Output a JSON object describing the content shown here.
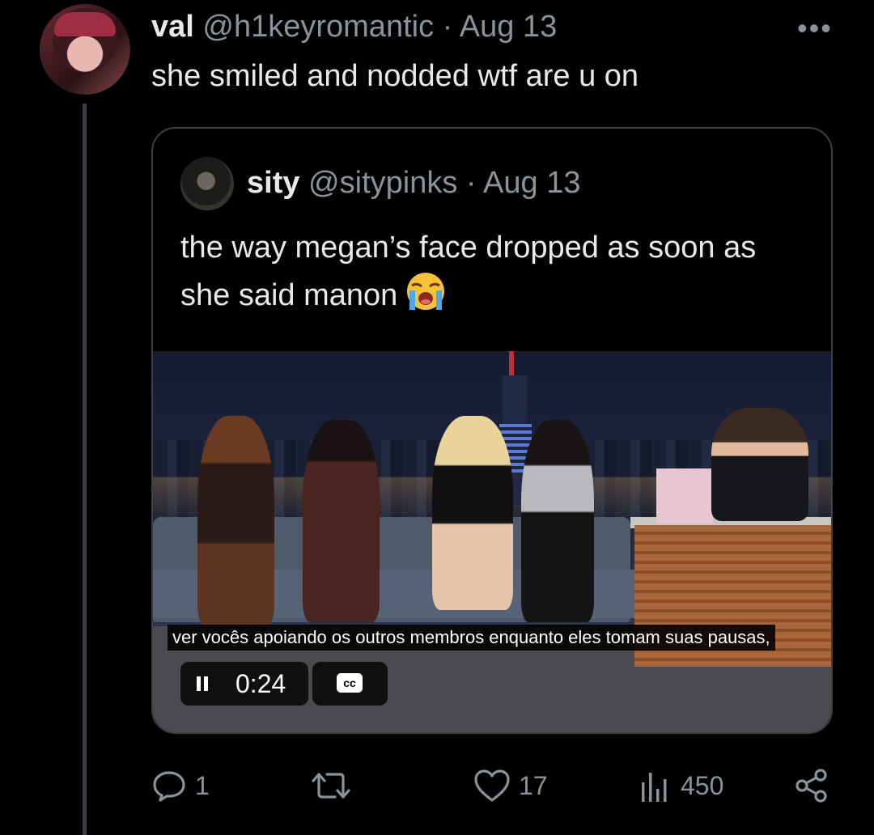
{
  "reply": {
    "name": "val",
    "handle": "@h1keyromantic",
    "separator": "·",
    "date": "Aug 13",
    "more": "•••",
    "text": "she smiled and nodded wtf are u on"
  },
  "quote": {
    "name": "sity",
    "handle": "@sitypinks",
    "separator": "·",
    "date": "Aug 13",
    "text": "the way megan’s face dropped as soon as she said manon",
    "emoji": "loudly-crying-face"
  },
  "video": {
    "subtitle": "ver vocês apoiando os outros membros enquanto eles tomam suas pausas,",
    "time": "0:24",
    "cc_label": "cc"
  },
  "actions": {
    "replies": "1",
    "retweets": "",
    "likes": "17",
    "views": "450"
  },
  "icons": {
    "reply": "reply-icon",
    "retweet": "retweet-icon",
    "like": "heart-icon",
    "views": "views-chart-icon",
    "share": "share-icon"
  },
  "colors": {
    "background": "#000000",
    "text": "#e7e9ea",
    "muted": "#8b9299",
    "border": "#3c4045"
  }
}
